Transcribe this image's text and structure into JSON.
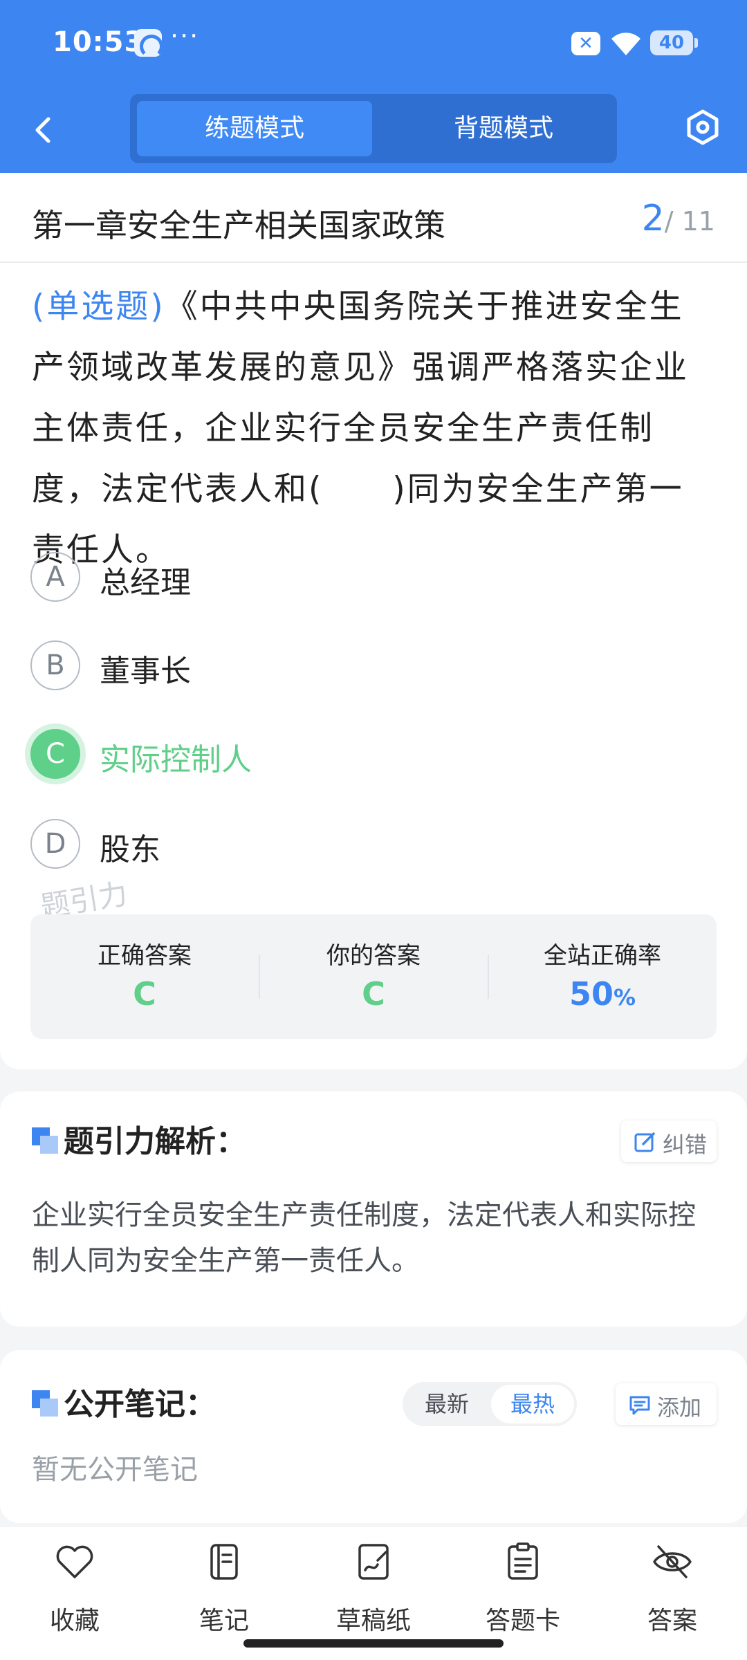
{
  "status_bar": {
    "time": "10:53",
    "dots": "···",
    "battery": "40"
  },
  "header": {
    "tabs": [
      {
        "label": "练题模式",
        "active": true
      },
      {
        "label": "背题模式",
        "active": false
      }
    ]
  },
  "question": {
    "chapter": "第一章安全生产相关国家政策",
    "progress_current": "2",
    "progress_total": "/ 11",
    "type": "(单选题)",
    "text": "《中共中央国务院关于推进安全生产领域改革发展的意见》强调严格落实企业主体责任，企业实行全员安全生产责任制度，法定代表人和(　　)同为安全生产第一责任人。",
    "options": [
      {
        "key": "A",
        "label": "总经理"
      },
      {
        "key": "B",
        "label": "董事长"
      },
      {
        "key": "C",
        "label": "实际控制人",
        "correct": true
      },
      {
        "key": "D",
        "label": "股东"
      }
    ],
    "watermark": "题引力"
  },
  "stats": {
    "correct_answer_label": "正确答案",
    "correct_answer": "C",
    "your_answer_label": "你的答案",
    "your_answer": "C",
    "accuracy_label": "全站正确率",
    "accuracy_value": "50",
    "accuracy_unit": "%"
  },
  "analysis": {
    "title": "题引力解析：",
    "report_label": "纠错",
    "text": "企业实行全员安全生产责任制度，法定代表人和实际控制人同为安全生产第一责任人。"
  },
  "notes": {
    "title": "公开笔记：",
    "sort_newest": "最新",
    "sort_hottest": "最热",
    "add_label": "添加",
    "empty_text": "暂无公开笔记"
  },
  "toolbar": {
    "items": [
      {
        "label": "收藏",
        "icon": "heart-icon"
      },
      {
        "label": "笔记",
        "icon": "notebook-icon"
      },
      {
        "label": "草稿纸",
        "icon": "draft-icon"
      },
      {
        "label": "答题卡",
        "icon": "answer-sheet-icon"
      },
      {
        "label": "答案",
        "icon": "eye-off-icon"
      }
    ]
  },
  "colors": {
    "primary": "#3d86f2",
    "correct": "#5fcf89",
    "text": "#222222",
    "muted": "#9aa0a8"
  }
}
